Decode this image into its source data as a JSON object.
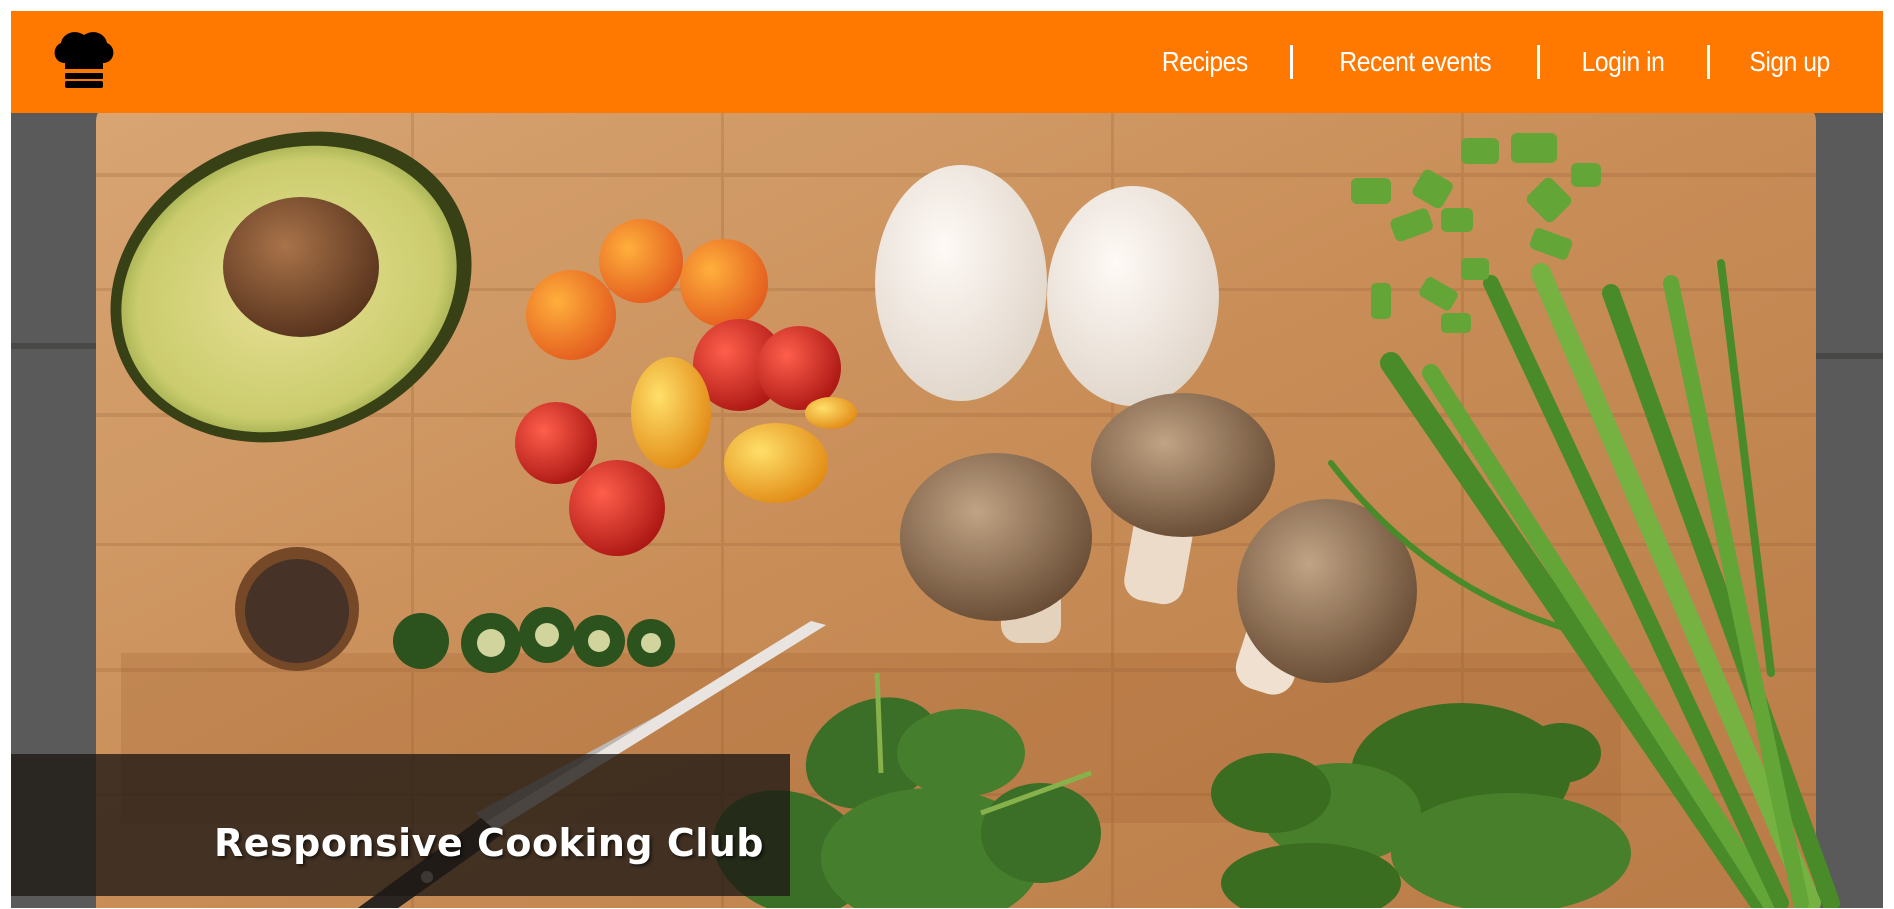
{
  "header": {
    "logo_icon": "chef-hat-icon",
    "accent_color": "#ff7800",
    "nav": [
      {
        "label": "Recipes"
      },
      {
        "label": "Recent events"
      },
      {
        "label": "Login in"
      },
      {
        "label": "Sign up"
      }
    ]
  },
  "hero": {
    "title": "Responsive Cooking Club",
    "image_icon": "cutting-board-ingredients-image"
  }
}
